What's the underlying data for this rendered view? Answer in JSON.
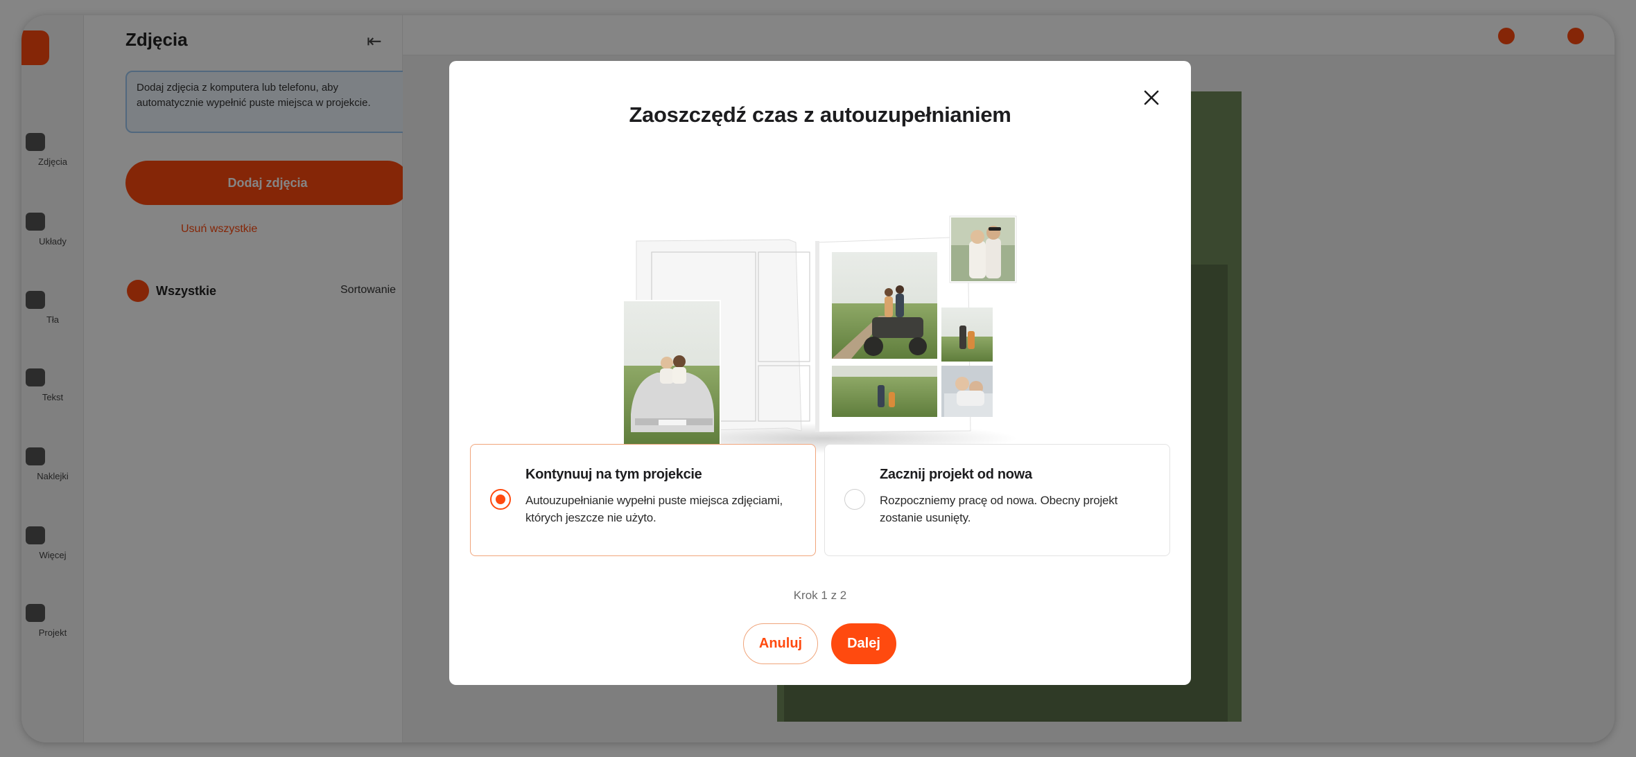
{
  "background": {
    "panel": {
      "title": "Zdjęcia",
      "info": "Dodaj zdjęcia z komputera lub telefonu, aby automatycznie wypełnić puste miejsca w projekcie.",
      "cta": "Dodaj zdjęcia",
      "link": "Usuń wszystkie",
      "section": "Wszystkie",
      "sort": "Sortowanie"
    },
    "rail": [
      "Projekt",
      "Zdjęcia",
      "Układy",
      "Tła",
      "Tekst",
      "Naklejki",
      "Więcej"
    ]
  },
  "modal": {
    "title": "Zaoszczędź czas z autouzupełnianiem",
    "options": [
      {
        "title": "Kontynuuj na tym projekcie",
        "description": "Autouzupełnianie wypełni puste miejsca zdjęciami, których jeszcze nie użyto.",
        "selected": true
      },
      {
        "title": "Zacznij projekt od nowa",
        "description": "Rozpoczniemy pracę od nowa. Obecny projekt zostanie usunięty.",
        "selected": false
      }
    ],
    "step": "Krok 1 z 2",
    "cancel_label": "Anuluj",
    "next_label": "Dalej",
    "close_icon": "close-icon"
  },
  "colors": {
    "accent": "#ff4a0f",
    "accent_border": "#f0a47a",
    "overlay": "rgba(0,0,0,0.48)"
  }
}
